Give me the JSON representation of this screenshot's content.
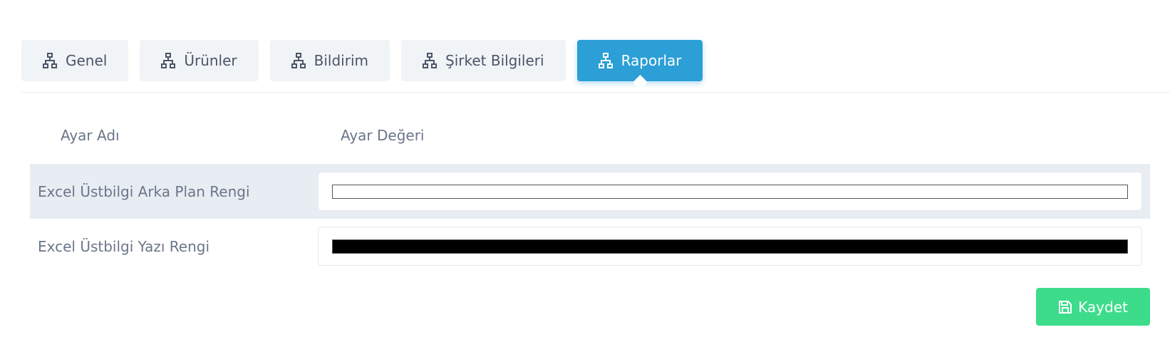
{
  "tabs": [
    {
      "label": "Genel",
      "icon": "sitemap-icon",
      "active": false
    },
    {
      "label": "Ürünler",
      "icon": "sitemap-icon",
      "active": false
    },
    {
      "label": "Bildirim",
      "icon": "sitemap-icon",
      "active": false
    },
    {
      "label": "Şirket Bilgileri",
      "icon": "sitemap-icon",
      "active": false
    },
    {
      "label": "Raporlar",
      "icon": "sitemap-icon",
      "active": true
    }
  ],
  "table": {
    "header_name": "Ayar Adı",
    "header_value": "Ayar Değeri",
    "rows": [
      {
        "name": "Excel Üstbilgi Arka Plan Rengi",
        "color": "#ffffff"
      },
      {
        "name": "Excel Üstbilgi Yazı Rengi",
        "color": "#000000"
      }
    ]
  },
  "save": {
    "label": "Kaydet",
    "icon": "save-icon"
  },
  "colors": {
    "active_tab": "#2b9fd6",
    "save_button": "#3ddc8b",
    "tab_bg": "#f1f4f6"
  }
}
